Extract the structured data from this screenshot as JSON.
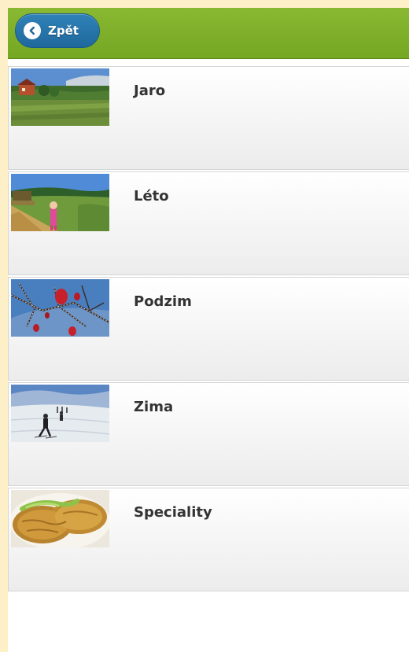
{
  "header": {
    "back_label": "Zpět",
    "bar_color": "#7aad27",
    "button_color": "#2673a8"
  },
  "list": {
    "items": [
      {
        "label": "Jaro"
      },
      {
        "label": "Léto"
      },
      {
        "label": "Podzim"
      },
      {
        "label": "Zima"
      },
      {
        "label": "Speciality"
      }
    ]
  }
}
